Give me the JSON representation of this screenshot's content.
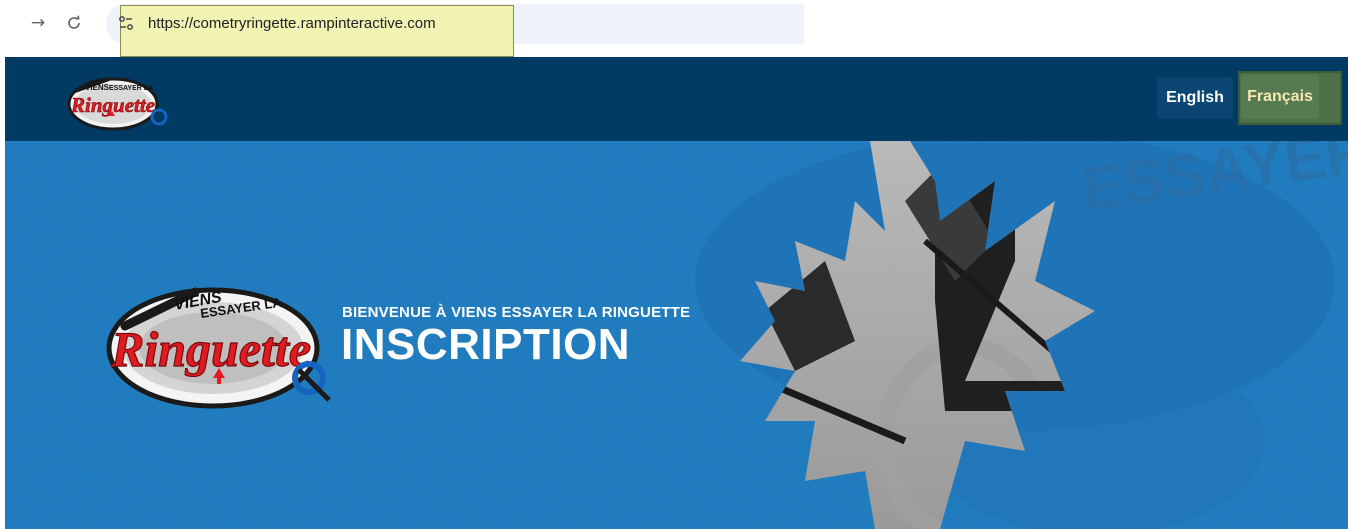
{
  "browser": {
    "forward_icon": "arrow-right-icon",
    "reload_icon": "reload-icon",
    "site_info_icon": "tune-icon",
    "url": "https://cometryringette.rampinteractive.com"
  },
  "header": {
    "logo_icon": "viens-essayer-la-ringuette-logo",
    "logo_text": [
      "VIENS",
      "ESSAYER LA",
      "Ringuette"
    ],
    "languages": [
      {
        "label": "English",
        "selected": false
      },
      {
        "label": "Français",
        "selected": true
      }
    ]
  },
  "hero": {
    "logo_text": [
      "VIENS",
      "ESSAYER LA",
      "Ringuette"
    ],
    "subtitle": "BIENVENUE À VIENS ESSAYER LA RINGUETTE",
    "title": "INSCRIPTION",
    "background_watermark": "ESSAYER LA"
  },
  "colors": {
    "header_bg": "#013a63",
    "hero_bg": "#1a75bb",
    "english_button_bg": "#0b4673",
    "francais_button_bg": "#567a52",
    "url_highlight": "#f1f3b3"
  }
}
